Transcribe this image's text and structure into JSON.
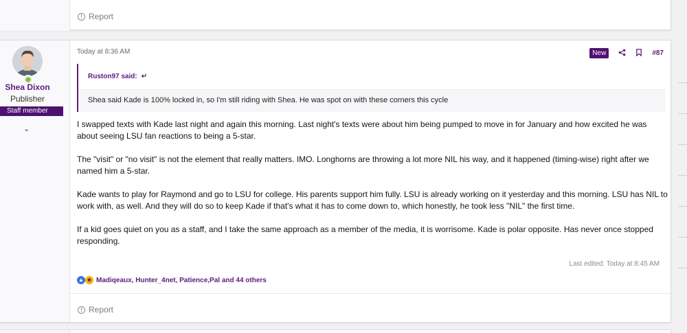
{
  "top_card": {
    "report_label": "Report"
  },
  "post": {
    "author": {
      "name": "Shea Dixon",
      "title": "Publisher",
      "banner": "Staff member"
    },
    "timestamp": "Today at 8:36 AM",
    "new_badge": "New",
    "post_number": "#87",
    "quote": {
      "author_label": "Ruston97 said:",
      "text": "Shea said Kade is 100% locked in, so I'm still riding with Shea. He was spot on with these corners this cycle"
    },
    "paragraphs": [
      "I swapped texts with Kade last night and again this morning. Last night's texts were about him being pumped to move in for January and how excited he was about seeing LSU fan reactions to being a 5-star.",
      "The \"visit\" or \"no visit\" is not the element that really matters. IMO. Longhorns are throwing a lot more NIL his way, and it happened (timing-wise) right after we named him a 5-star.",
      "Kade wants to play for Raymond and go to LSU for college. His parents support him fully. LSU is already working on it yesterday and this morning. LSU has NIL to work with, as well. And they will do so to keep Kade if that's what it has to come down to, which honestly, he took less \"NIL\" the first time.",
      "If a kid goes quiet on you as a staff, and I take the same approach as a member of the media, it is worrisome. Kade is polar opposite. Has never once stopped responding."
    ],
    "edited": "Last edited: Today at 8:45 AM",
    "reactions_text": "Madiqeaux, Hunter_4net, Patience,Pal and 44 others",
    "report_label": "Report"
  },
  "icons": {
    "report": "info-circle-icon",
    "share": "share-icon",
    "bookmark": "bookmark-icon",
    "quote_jump": "arrow-return-icon",
    "expand": "chevron-down-icon",
    "online": "online-status-icon",
    "like": "thumbs-up-icon",
    "laugh": "laugh-icon"
  },
  "colors": {
    "brand_purple": "#5b1d7d",
    "staff_banner": "#4f1170",
    "online_green": "#7cb342"
  }
}
